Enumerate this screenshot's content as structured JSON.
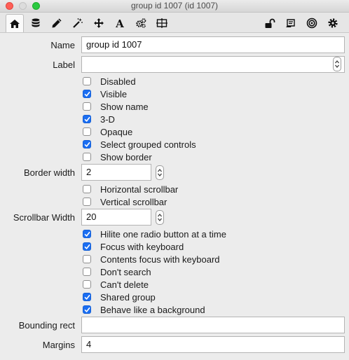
{
  "window": {
    "title": "group id 1007 (id 1007)"
  },
  "toolbar": {
    "left_icons": [
      "home-icon",
      "database-icon",
      "pencil-icon",
      "magic-wand-icon",
      "move-arrows-icon",
      "text-font-icon",
      "gears-icon",
      "layout-grid-icon"
    ],
    "right_icons": [
      "lock-icon",
      "message-stamp-icon",
      "target-icon",
      "settings-gear-icon"
    ],
    "active": "home-icon"
  },
  "form": {
    "name": {
      "label": "Name",
      "value": "group id 1007"
    },
    "label_field": {
      "label": "Label",
      "value": ""
    },
    "checkboxes_1": [
      {
        "label": "Disabled",
        "checked": false
      },
      {
        "label": "Visible",
        "checked": true
      },
      {
        "label": "Show name",
        "checked": false
      },
      {
        "label": "3-D",
        "checked": true
      },
      {
        "label": "Opaque",
        "checked": false
      },
      {
        "label": "Select grouped controls",
        "checked": true
      },
      {
        "label": "Show border",
        "checked": false
      }
    ],
    "border_width": {
      "label": "Border width",
      "value": "2"
    },
    "checkboxes_2": [
      {
        "label": "Horizontal scrollbar",
        "checked": false
      },
      {
        "label": "Vertical scrollbar",
        "checked": false
      }
    ],
    "scrollbar_width": {
      "label": "Scrollbar Width",
      "value": "20"
    },
    "checkboxes_3": [
      {
        "label": "Hilite one radio button at a time",
        "checked": true
      },
      {
        "label": "Focus with keyboard",
        "checked": true
      },
      {
        "label": "Contents focus with keyboard",
        "checked": false
      },
      {
        "label": "Don't search",
        "checked": false
      },
      {
        "label": "Can't delete",
        "checked": false
      },
      {
        "label": "Shared group",
        "checked": true
      },
      {
        "label": "Behave like a background",
        "checked": true
      }
    ],
    "bounding_rect": {
      "label": "Bounding rect",
      "value": ""
    },
    "margins": {
      "label": "Margins",
      "value": "4"
    }
  },
  "colors": {
    "checkbox_checked": "#1b6ef2",
    "window_bg": "#ececec"
  }
}
